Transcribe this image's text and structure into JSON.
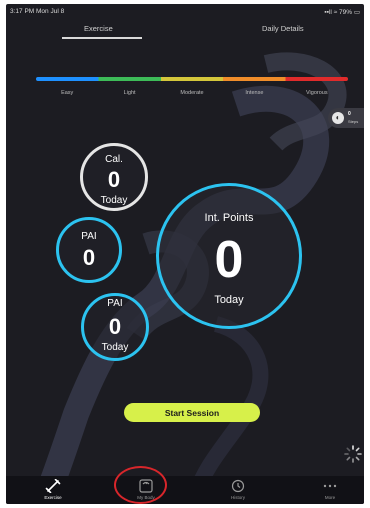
{
  "status_bar": {
    "time": "3:17 PM  Mon Jul 8",
    "indicators": "▪▪ll ≈ 79% ▭"
  },
  "tabs": [
    {
      "label": "Exercise",
      "active": true
    },
    {
      "label": "Daily Details",
      "active": false
    }
  ],
  "intensity": {
    "levels": [
      "Easy",
      "Light",
      "Moderate",
      "Intense",
      "Vigorous"
    ],
    "colors": [
      "#1e90ff",
      "#3dbb58",
      "#d4c63b",
      "#f08d2a",
      "#e02b2b"
    ]
  },
  "steps_badge": {
    "value": "0",
    "unit": "Steps",
    "icon": "footprint-icon"
  },
  "metrics": {
    "calories": {
      "label": "Cal.",
      "value": "0",
      "period": "Today"
    },
    "int_points": {
      "label": "Int. Points",
      "value": "0",
      "period": "Today"
    },
    "pai_1": {
      "label": "PAI",
      "value": "0"
    },
    "pai_2": {
      "label": "PAI",
      "value": "0",
      "period": "Today"
    }
  },
  "start_session": {
    "label": "Start Session"
  },
  "bottom_nav": [
    {
      "label": "Exercise",
      "icon": "dumbbell-icon",
      "active": true
    },
    {
      "label": "My Body",
      "icon": "scale-icon",
      "active": false
    },
    {
      "label": "History",
      "icon": "history-icon",
      "active": false
    },
    {
      "label": "More",
      "icon": "more-icon",
      "active": false
    }
  ],
  "colors": {
    "accent_ring": "#2cc3f0",
    "button": "#d7f04a",
    "highlight": "#d8262b",
    "background": "#1c1c22"
  }
}
